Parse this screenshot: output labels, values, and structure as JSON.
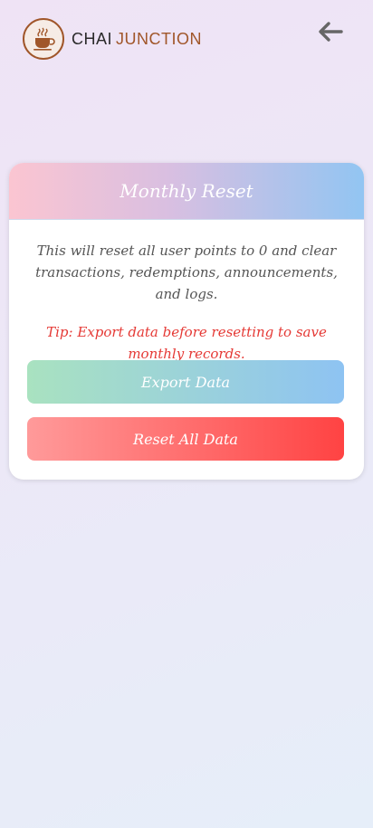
{
  "app": {
    "logo_word1": "CHAI",
    "logo_word2": "JUNCTION",
    "back_icon": "arrow-left-icon",
    "logo_icon": "chai-cup-icon"
  },
  "card": {
    "title": "Monthly Reset",
    "description": "This will reset all user points to 0 and clear transactions, redemptions, announcements, and logs.",
    "tip": "Tip: Export data before resetting to save monthly records.",
    "export_label": "Export Data",
    "reset_label": "Reset All Data"
  },
  "colors": {
    "brand": "#a0562a",
    "tip_red": "#e53935",
    "reset_red": "#ff4343",
    "export_blue": "#8ec3f2",
    "export_green": "#a9e2c0"
  }
}
